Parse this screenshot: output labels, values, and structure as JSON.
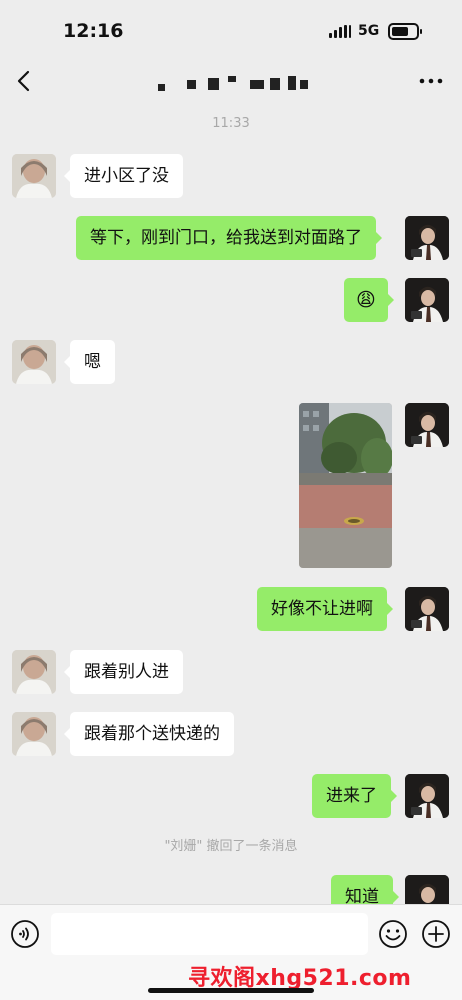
{
  "status_bar": {
    "time": "12:16",
    "network": "5G",
    "battery_level": 0.7
  },
  "nav": {
    "contact_name": "▘▗▙▘ ▄▖▚▗",
    "back_icon": "chevron-left-icon",
    "more_icon": "more-dots-icon"
  },
  "messages": [
    {
      "type": "timestamp",
      "text": "11:33"
    },
    {
      "type": "text",
      "from": "friend",
      "text": "进小区了没"
    },
    {
      "type": "text",
      "from": "me",
      "text": "等下，刚到门口，给我送到对面路了"
    },
    {
      "type": "emoji",
      "from": "me",
      "text": "😩"
    },
    {
      "type": "text",
      "from": "friend",
      "text": "嗯"
    },
    {
      "type": "image",
      "from": "me",
      "description": "street-photo"
    },
    {
      "type": "text",
      "from": "me",
      "text": "好像不让进啊"
    },
    {
      "type": "text",
      "from": "friend",
      "text": "跟着别人进"
    },
    {
      "type": "text",
      "from": "friend",
      "text": "跟着那个送快递的"
    },
    {
      "type": "text",
      "from": "me",
      "text": "进来了"
    },
    {
      "type": "system",
      "text": "\"刘姗\" 撤回了一条消息"
    },
    {
      "type": "text",
      "from": "me",
      "text": "知道"
    }
  ],
  "input_bar": {
    "voice_icon": "voice-icon",
    "emoji_icon": "emoji-icon",
    "plus_icon": "plus-icon",
    "placeholder": ""
  },
  "watermark": "寻欢阁xhg521.com",
  "colors": {
    "background": "#ededed",
    "my_bubble": "#95ec69",
    "friend_bubble": "#ffffff",
    "watermark": "#ee1f2e"
  }
}
